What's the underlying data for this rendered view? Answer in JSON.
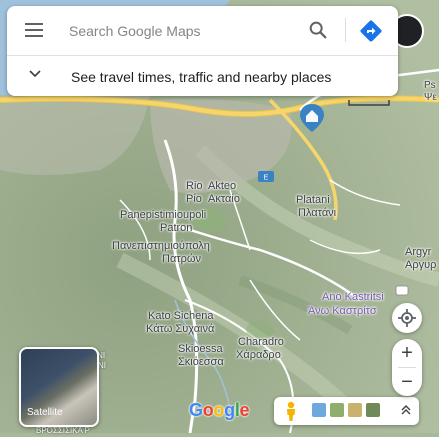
{
  "search": {
    "placeholder": "Search Google Maps",
    "hint": "See travel times, traffic and nearby places"
  },
  "places": {
    "rio_latin": "Rio",
    "akteo_latin": "Akteo",
    "rio_greek": "Ρίο",
    "akteo_greek": "Ακταίο",
    "platani_latin": "Platani",
    "platani_greek": "Πλατάνι",
    "panepistimioupoli_latin": "Panepistimioupoli",
    "patron_latin": "Patron",
    "panepistimioupoli_greek": "Πανεπιστημιούπολη",
    "patron_greek": "Πατρών",
    "argyra_latin": "Argyr",
    "argyra_greek": "Αργυρ",
    "ano_kastritsi_latin": "Ano Kastritsi",
    "ano_kastritsi_greek": "Άνω Καστρίτσ",
    "kato_sichena_latin": "Kato Sichena",
    "kato_sichena_greek": "Κάτω Συχαινά",
    "charadro_latin": "Charadro",
    "charadro_greek": "Χάραδρο",
    "skioessa_latin": "Skioessa",
    "skioessa_greek": "Σκιόεσσα",
    "top_right_fragment_1": "Ps",
    "top_right_fragment_2": "Ψε",
    "left_fragment_1": "VLANI",
    "left_fragment_2": "BAANI",
    "bottom_fragment": "ΒΡΟΣΣΙΣΙΚΑ Ρ"
  },
  "controls": {
    "satellite_label": "Satellite",
    "zoom_in": "+",
    "zoom_out": "−",
    "google_logo": "Google"
  },
  "colors": {
    "terrain": "#a9b89a",
    "road_yellow": "#f6d66b",
    "road_white": "#ffffff",
    "pin": "#3b82c4",
    "directions_blue": "#1a73e8",
    "urban": "#b8b8ad"
  },
  "icons": {
    "menu": "hamburger-icon",
    "search": "magnifier-icon",
    "directions": "directions-diamond-icon",
    "expand": "chevron-down-icon",
    "pegman": "pegman-icon",
    "locate": "my-location-icon",
    "expand_layers": "chevron-up-icon"
  }
}
